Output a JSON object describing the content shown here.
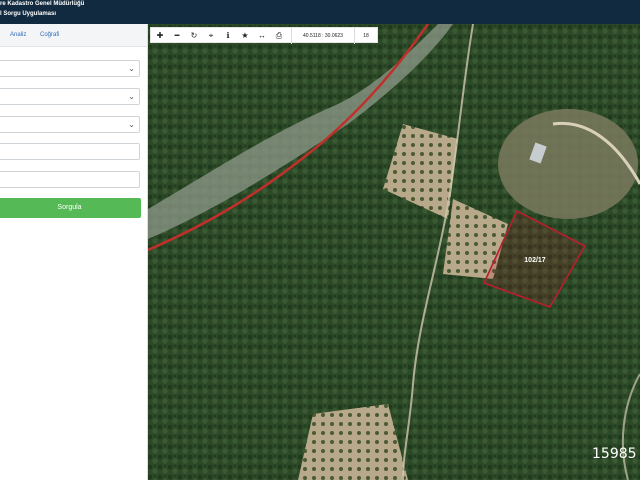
{
  "header": {
    "line1": "re Kadastro Genel Müdürlüğü",
    "line2": "l Sorgu Uygulaması"
  },
  "sidebar": {
    "tabs": [
      {
        "label": "Analiz"
      },
      {
        "label": "Coğrafi"
      }
    ],
    "query_button_label": "Sorgula"
  },
  "map": {
    "toolbar": {
      "coordinates": "40.5118 : 30.0623",
      "zoom_level": "18"
    },
    "parcel_label": "102/17",
    "scale_text": "15985"
  },
  "colors": {
    "header_bg": "#122a3f",
    "button_green": "#55b955",
    "parcel_outline": "#b81e2e",
    "road_line": "#c0302b"
  },
  "icons": [
    "zoom-in-icon",
    "zoom-out-icon",
    "refresh-icon",
    "locate-icon",
    "info-icon",
    "star-icon",
    "measure-icon",
    "print-icon"
  ]
}
